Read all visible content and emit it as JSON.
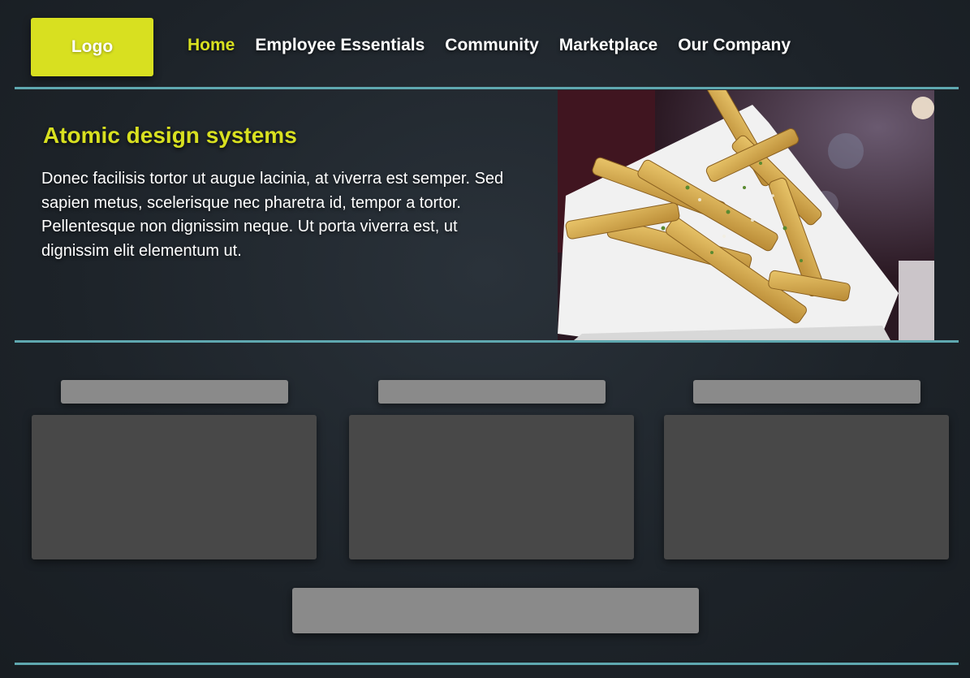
{
  "header": {
    "logo_label": "Logo",
    "nav": [
      {
        "label": "Home",
        "active": true
      },
      {
        "label": "Employee Essentials",
        "active": false
      },
      {
        "label": "Community",
        "active": false
      },
      {
        "label": "Marketplace",
        "active": false
      },
      {
        "label": "Our Company",
        "active": false
      }
    ]
  },
  "hero": {
    "title": "Atomic design systems",
    "body": "Donec facilisis tortor ut augue lacinia, at viverra est semper. Sed sapien metus, scelerisque nec pharetra id, tempor a tortor. Pellentesque non dignissim neque. Ut porta viverra est, ut dignissim elit elementum ut.",
    "image_subject": "basket of french fries"
  },
  "colors": {
    "accent": "#d8e020",
    "divider": "#5fa8b0",
    "placeholder_label": "#8a8a8a",
    "placeholder_card": "#484848",
    "background": "#1d2329"
  },
  "cards": [
    {
      "label": "",
      "content": ""
    },
    {
      "label": "",
      "content": ""
    },
    {
      "label": "",
      "content": ""
    }
  ],
  "cta": {
    "label": ""
  }
}
